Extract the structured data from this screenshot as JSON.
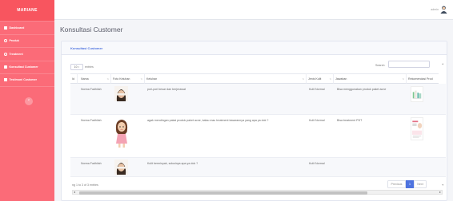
{
  "brand": "MARIANE",
  "sidebar": {
    "items": [
      {
        "label": "Dashboard",
        "icon": "dashboard-icon"
      },
      {
        "label": "Produk",
        "icon": "box-icon"
      },
      {
        "label": "Treatment",
        "icon": "spa-icon"
      },
      {
        "label": "Konsultasi Customer",
        "icon": "chat-icon"
      },
      {
        "label": "Testimoni Customer",
        "icon": "comment-icon"
      }
    ],
    "toggle": "‹"
  },
  "topbar": {
    "admin_name": "admin"
  },
  "page_title": "Konsultasi Customer",
  "card": {
    "header": "Konsultasi Customer",
    "length_value": "10",
    "length_suffix": "entries",
    "search_label": "Search:",
    "search_value": ""
  },
  "table": {
    "headers": [
      "Id",
      "Nama",
      "Foto Keluhan",
      "Keluhan",
      "Jenis Kulit",
      "Jawaban",
      "Rekomendasi Prod"
    ],
    "rows": [
      {
        "nama": "Norma Fadhilah",
        "keluhan": "pori-pori besar dan berjerawat",
        "jenis_kulit": "Kulit Normal",
        "jawaban": "Bisa menggunakan produk paket acne"
      },
      {
        "nama": "Norma Fadhilah",
        "keluhan": "agak mendingan pakai produk paket acne, kalau mau treatment tawarannya yang apa ya dok ?",
        "jenis_kulit": "Kulit Normal",
        "jawaban": "Bisa treatment PDT"
      },
      {
        "nama": "Norma Fadhilah",
        "keluhan": "Kulit berminyak, solusinya apa ya dok ?",
        "jenis_kulit": "Kulit Normal",
        "jawaban": ""
      }
    ]
  },
  "footer": {
    "info": "ng 1 to 3 of 3 entries",
    "previous": "Previous",
    "page": "1",
    "next": "Next"
  },
  "colors": {
    "sidebar": "#fb6b78",
    "brand_bg": "#f8555f",
    "accent": "#4e73df"
  }
}
